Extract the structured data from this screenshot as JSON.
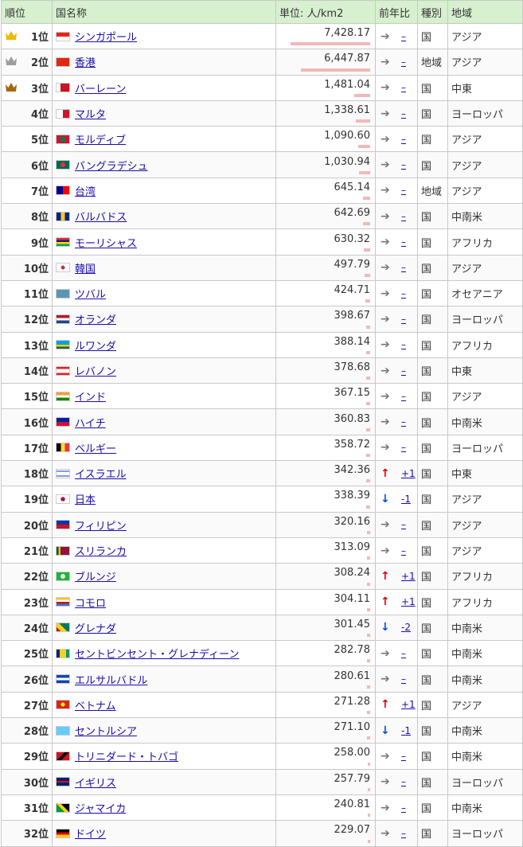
{
  "header": {
    "rank": "順位",
    "name": "国名称",
    "unit": "単位: 人/km2",
    "change": "前年比",
    "type": "種別",
    "region": "地域"
  },
  "colors": {
    "header_bg": "#d7f0cf",
    "bar": "#f4b7b7",
    "gold": "#f2b705",
    "silver": "#9e9e9e",
    "bronze": "#a8660e",
    "up": "#e00000",
    "down": "#0050e0"
  },
  "max_value": 7428.17,
  "rows": [
    {
      "rank": "1位",
      "crown": "gold-crown-icon",
      "name": "シンガポール",
      "flag": "singapore-flag-icon",
      "value": "7,428.17",
      "num": 7428.17,
      "trend": "same",
      "change": "–",
      "type": "国",
      "region": "アジア"
    },
    {
      "rank": "2位",
      "crown": "silver-crown-icon",
      "name": "香港",
      "flag": "hong-kong-flag-icon",
      "value": "6,447.87",
      "num": 6447.87,
      "trend": "same",
      "change": "–",
      "type": "地域",
      "region": "アジア"
    },
    {
      "rank": "3位",
      "crown": "bronze-crown-icon",
      "name": "バーレーン",
      "flag": "bahrain-flag-icon",
      "value": "1,481.04",
      "num": 1481.04,
      "trend": "same",
      "change": "–",
      "type": "国",
      "region": "中東"
    },
    {
      "rank": "4位",
      "name": "マルタ",
      "flag": "malta-flag-icon",
      "value": "1,338.61",
      "num": 1338.61,
      "trend": "same",
      "change": "–",
      "type": "国",
      "region": "ヨーロッパ"
    },
    {
      "rank": "5位",
      "name": "モルディブ",
      "flag": "maldives-flag-icon",
      "value": "1,090.60",
      "num": 1090.6,
      "trend": "same",
      "change": "–",
      "type": "国",
      "region": "アジア"
    },
    {
      "rank": "6位",
      "name": "バングラデシュ",
      "flag": "bangladesh-flag-icon",
      "value": "1,030.94",
      "num": 1030.94,
      "trend": "same",
      "change": "–",
      "type": "国",
      "region": "アジア"
    },
    {
      "rank": "7位",
      "name": "台湾",
      "flag": "taiwan-flag-icon",
      "value": "645.14",
      "num": 645.14,
      "trend": "same",
      "change": "–",
      "type": "地域",
      "region": "アジア"
    },
    {
      "rank": "8位",
      "name": "バルバドス",
      "flag": "barbados-flag-icon",
      "value": "642.69",
      "num": 642.69,
      "trend": "same",
      "change": "–",
      "type": "国",
      "region": "中南米"
    },
    {
      "rank": "9位",
      "name": "モーリシャス",
      "flag": "mauritius-flag-icon",
      "value": "630.32",
      "num": 630.32,
      "trend": "same",
      "change": "–",
      "type": "国",
      "region": "アフリカ"
    },
    {
      "rank": "10位",
      "name": "韓国",
      "flag": "south-korea-flag-icon",
      "value": "497.79",
      "num": 497.79,
      "trend": "same",
      "change": "–",
      "type": "国",
      "region": "アジア"
    },
    {
      "rank": "11位",
      "name": "ツバル",
      "flag": "tuvalu-flag-icon",
      "value": "424.71",
      "num": 424.71,
      "trend": "same",
      "change": "–",
      "type": "国",
      "region": "オセアニア"
    },
    {
      "rank": "12位",
      "name": "オランダ",
      "flag": "netherlands-flag-icon",
      "value": "398.67",
      "num": 398.67,
      "trend": "same",
      "change": "–",
      "type": "国",
      "region": "ヨーロッパ"
    },
    {
      "rank": "13位",
      "name": "ルワンダ",
      "flag": "rwanda-flag-icon",
      "value": "388.14",
      "num": 388.14,
      "trend": "same",
      "change": "–",
      "type": "国",
      "region": "アフリカ"
    },
    {
      "rank": "14位",
      "name": "レバノン",
      "flag": "lebanon-flag-icon",
      "value": "378.68",
      "num": 378.68,
      "trend": "same",
      "change": "–",
      "type": "国",
      "region": "中東"
    },
    {
      "rank": "15位",
      "name": "インド",
      "flag": "india-flag-icon",
      "value": "367.15",
      "num": 367.15,
      "trend": "same",
      "change": "–",
      "type": "国",
      "region": "アジア"
    },
    {
      "rank": "16位",
      "name": "ハイチ",
      "flag": "haiti-flag-icon",
      "value": "360.83",
      "num": 360.83,
      "trend": "same",
      "change": "–",
      "type": "国",
      "region": "中南米"
    },
    {
      "rank": "17位",
      "name": "ベルギー",
      "flag": "belgium-flag-icon",
      "value": "358.72",
      "num": 358.72,
      "trend": "same",
      "change": "–",
      "type": "国",
      "region": "ヨーロッパ"
    },
    {
      "rank": "18位",
      "name": "イスラエル",
      "flag": "israel-flag-icon",
      "value": "342.36",
      "num": 342.36,
      "trend": "up",
      "change": "+1",
      "type": "国",
      "region": "中東"
    },
    {
      "rank": "19位",
      "name": "日本",
      "flag": "japan-flag-icon",
      "value": "338.39",
      "num": 338.39,
      "trend": "down",
      "change": "-1",
      "type": "国",
      "region": "アジア"
    },
    {
      "rank": "20位",
      "name": "フィリピン",
      "flag": "philippines-flag-icon",
      "value": "320.16",
      "num": 320.16,
      "trend": "same",
      "change": "–",
      "type": "国",
      "region": "アジア"
    },
    {
      "rank": "21位",
      "name": "スリランカ",
      "flag": "sri-lanka-flag-icon",
      "value": "313.09",
      "num": 313.09,
      "trend": "same",
      "change": "–",
      "type": "国",
      "region": "アジア"
    },
    {
      "rank": "22位",
      "name": "ブルンジ",
      "flag": "burundi-flag-icon",
      "value": "308.24",
      "num": 308.24,
      "trend": "up",
      "change": "+1",
      "type": "国",
      "region": "アフリカ"
    },
    {
      "rank": "23位",
      "name": "コモロ",
      "flag": "comoros-flag-icon",
      "value": "304.11",
      "num": 304.11,
      "trend": "up",
      "change": "+1",
      "type": "国",
      "region": "アフリカ"
    },
    {
      "rank": "24位",
      "name": "グレナダ",
      "flag": "grenada-flag-icon",
      "value": "301.45",
      "num": 301.45,
      "trend": "down",
      "change": "-2",
      "type": "国",
      "region": "中南米"
    },
    {
      "rank": "25位",
      "name": "セントビンセント・グレナディーン",
      "flag": "saint-vincent-flag-icon",
      "value": "282.78",
      "num": 282.78,
      "trend": "same",
      "change": "–",
      "type": "国",
      "region": "中南米"
    },
    {
      "rank": "26位",
      "name": "エルサルバドル",
      "flag": "el-salvador-flag-icon",
      "value": "280.61",
      "num": 280.61,
      "trend": "same",
      "change": "–",
      "type": "国",
      "region": "中南米"
    },
    {
      "rank": "27位",
      "name": "ベトナム",
      "flag": "vietnam-flag-icon",
      "value": "271.28",
      "num": 271.28,
      "trend": "up",
      "change": "+1",
      "type": "国",
      "region": "アジア"
    },
    {
      "rank": "28位",
      "name": "セントルシア",
      "flag": "saint-lucia-flag-icon",
      "value": "271.10",
      "num": 271.1,
      "trend": "down",
      "change": "-1",
      "type": "国",
      "region": "中南米"
    },
    {
      "rank": "29位",
      "name": "トリニダード・トバゴ",
      "flag": "trinidad-tobago-flag-icon",
      "value": "258.00",
      "num": 258.0,
      "trend": "same",
      "change": "–",
      "type": "国",
      "region": "中南米"
    },
    {
      "rank": "30位",
      "name": "イギリス",
      "flag": "united-kingdom-flag-icon",
      "value": "257.79",
      "num": 257.79,
      "trend": "same",
      "change": "–",
      "type": "国",
      "region": "ヨーロッパ"
    },
    {
      "rank": "31位",
      "name": "ジャマイカ",
      "flag": "jamaica-flag-icon",
      "value": "240.81",
      "num": 240.81,
      "trend": "same",
      "change": "–",
      "type": "国",
      "region": "中南米"
    },
    {
      "rank": "32位",
      "name": "ドイツ",
      "flag": "germany-flag-icon",
      "value": "229.07",
      "num": 229.07,
      "trend": "same",
      "change": "–",
      "type": "国",
      "region": "ヨーロッパ"
    }
  ]
}
